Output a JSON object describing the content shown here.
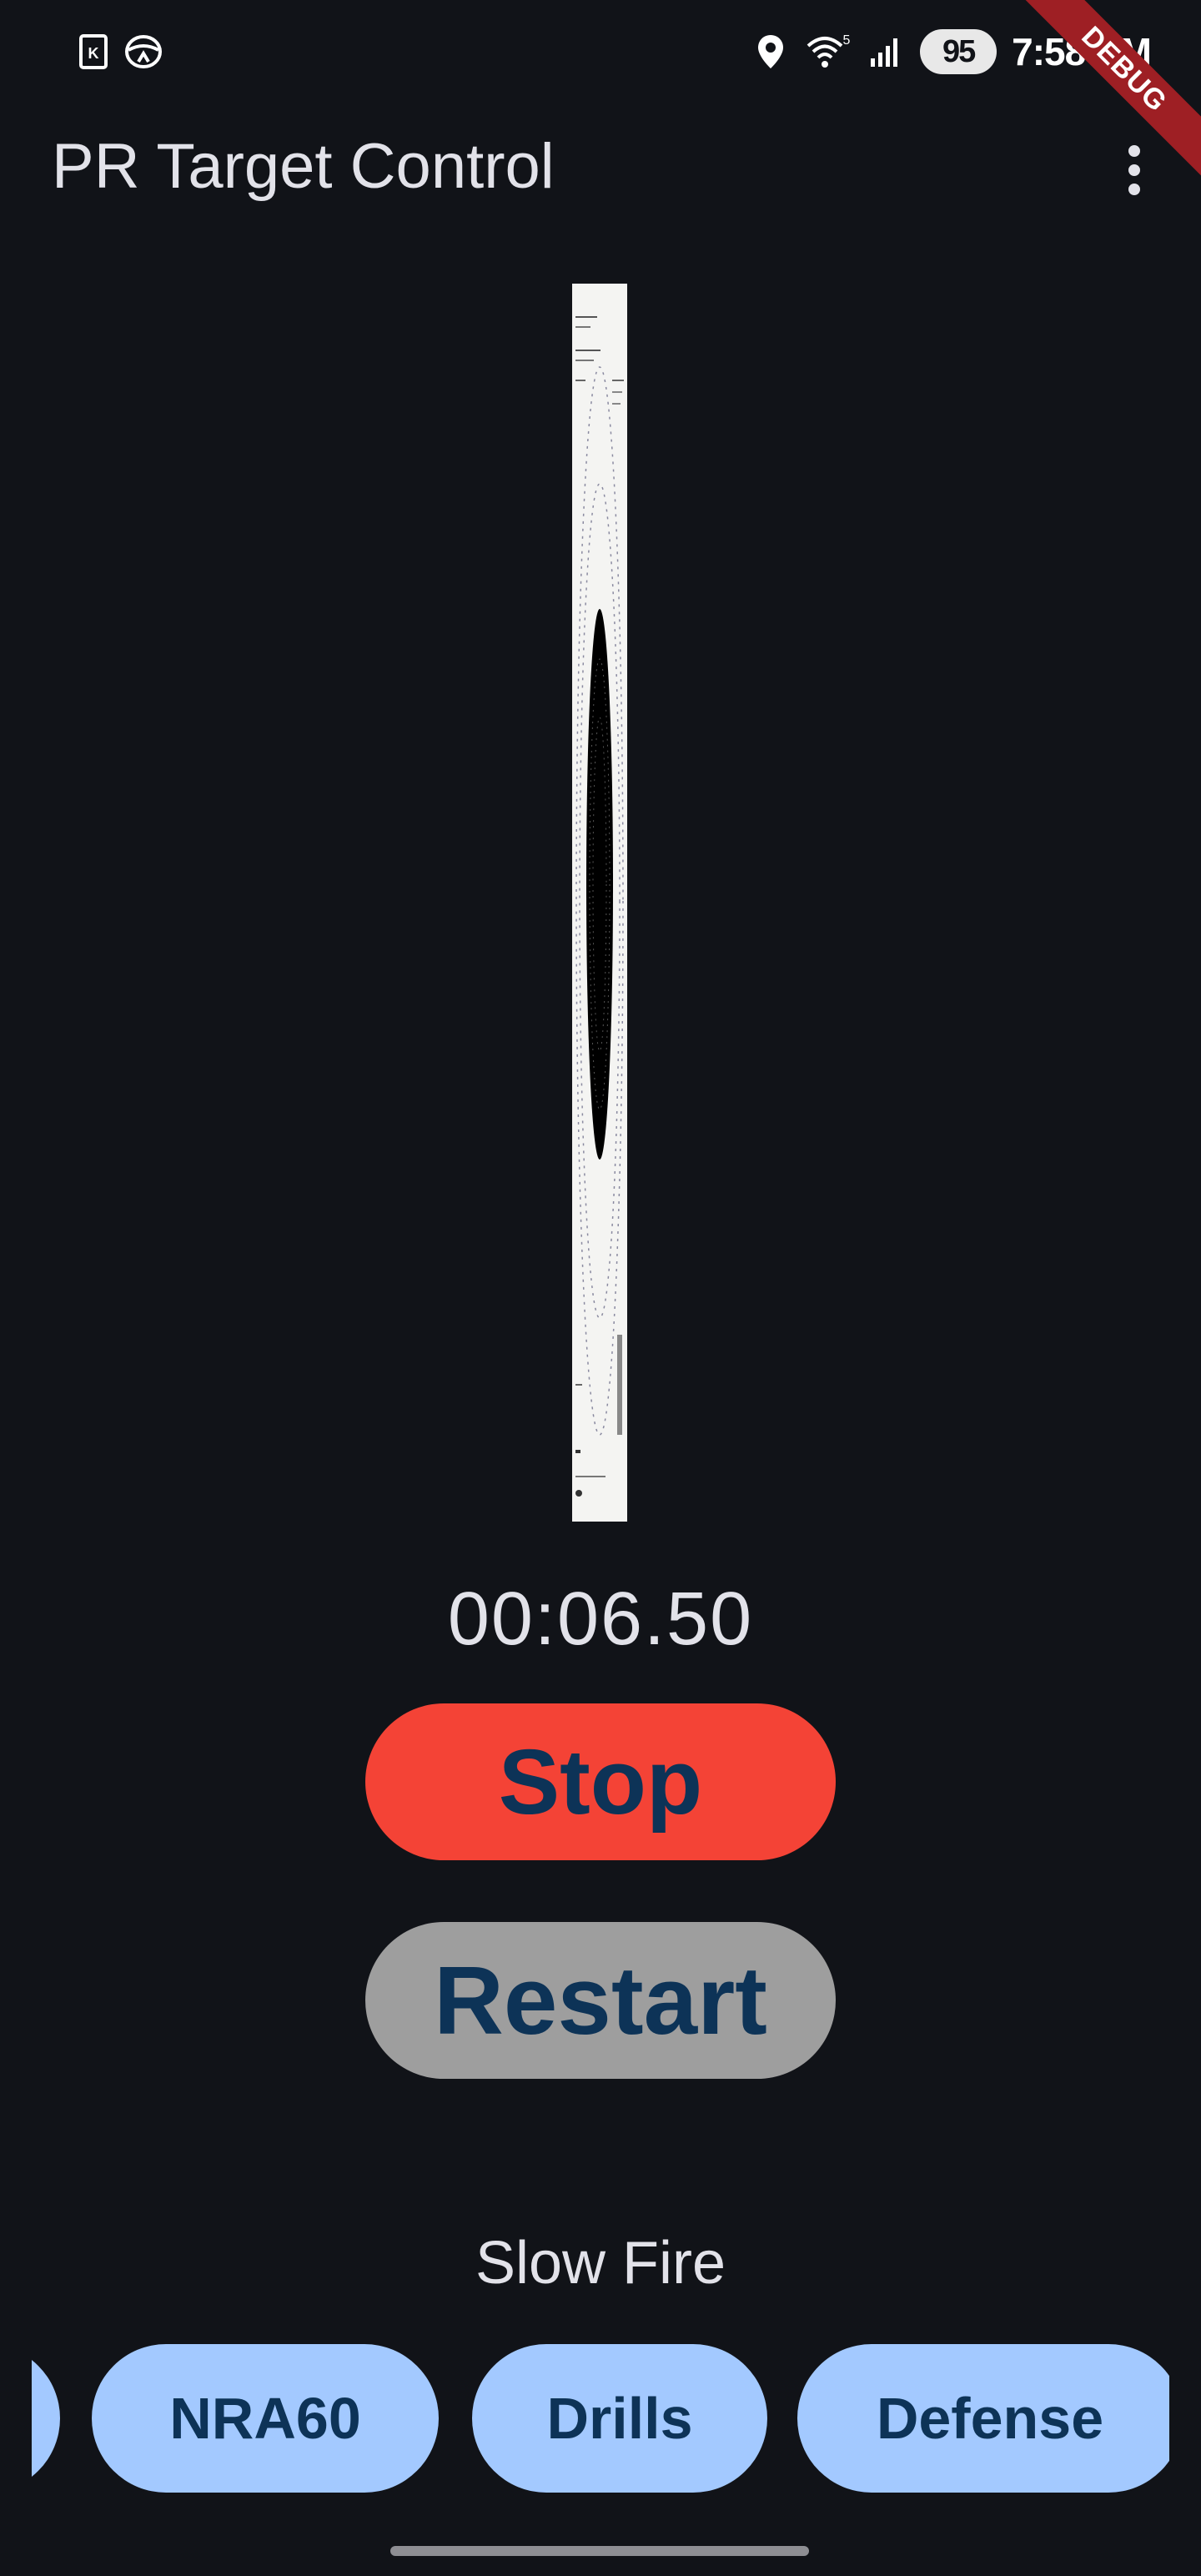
{
  "status_bar": {
    "time": "7:58 PM",
    "battery_level": "95",
    "network_label": "5",
    "left_icons": [
      "kindle-icon",
      "steering-wheel-icon"
    ],
    "right_icons": [
      "location-icon",
      "wifi-icon",
      "signal-icon"
    ]
  },
  "debug_banner": {
    "label": "DEBUG",
    "color": "#9e1f24"
  },
  "app_bar": {
    "title": "PR Target Control",
    "menu_icon": "more-vert-icon"
  },
  "timer": {
    "value": "00:06.50"
  },
  "buttons": {
    "stop_label": "Stop",
    "restart_label": "Restart",
    "stop_color": "#f44336",
    "restart_color": "#9e9e9e"
  },
  "mode": {
    "label": "Slow Fire"
  },
  "chips": [
    {
      "label": ""
    },
    {
      "label": "NRA60"
    },
    {
      "label": "Drills"
    },
    {
      "label": "Defense"
    }
  ],
  "colors": {
    "background": "#111318",
    "chip": "#a3c9ff",
    "on_chip": "#0d3357"
  }
}
